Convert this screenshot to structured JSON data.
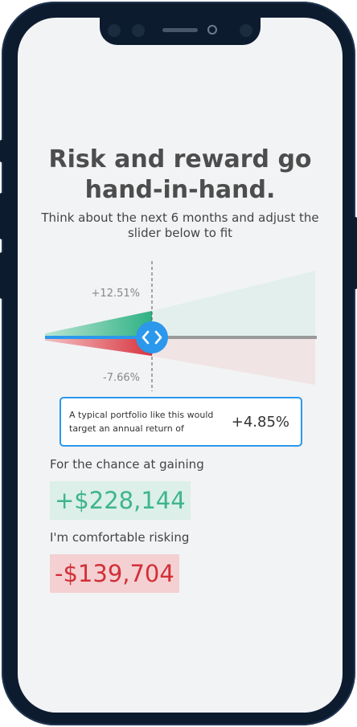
{
  "header": {
    "title_line1": "Risk and reward go",
    "title_line2": "hand-in-hand.",
    "subtitle": "Think about the next 6 months and adjust the slider below to fit"
  },
  "slider": {
    "upper_label": "+12.51%",
    "lower_label": "-7.66%",
    "handle_icon": "code-chevrons-icon",
    "level": 0.4,
    "colors": {
      "track_active": "#2b98ec",
      "track_inactive": "#9a9a9a",
      "gain": "#3dbb8f",
      "loss": "#d83a45"
    }
  },
  "info": {
    "text": "A typical portfolio like this would target an annual return of",
    "value": "+4.85%"
  },
  "gain": {
    "label": "For the chance at gaining",
    "value": "+$228,144",
    "color": "#3eb58c"
  },
  "risk": {
    "label": "I'm comfortable risking",
    "value": "-$139,704",
    "color": "#d23038"
  }
}
